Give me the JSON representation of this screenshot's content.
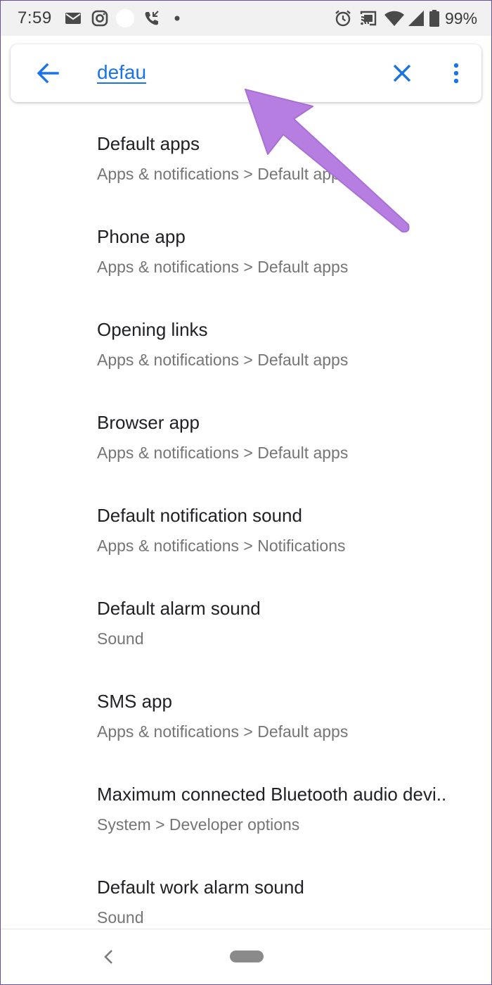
{
  "status_bar": {
    "time": "7:59",
    "battery_percent": "99%",
    "icons": [
      "email-icon",
      "instagram-icon",
      "circle-notification-icon",
      "missed-call-icon",
      "dot-icon",
      "alarm-icon",
      "cast-icon",
      "wifi-icon",
      "signal-icon",
      "battery-icon"
    ]
  },
  "search": {
    "query": "defau",
    "back_icon": "arrow-back-icon",
    "clear_icon": "close-icon",
    "menu_icon": "more-vert-icon",
    "accent_color": "#1a73e8"
  },
  "results": [
    {
      "title": "Default apps",
      "path": "Apps & notifications > Default apps"
    },
    {
      "title": "Phone app",
      "path": "Apps & notifications > Default apps"
    },
    {
      "title": "Opening links",
      "path": "Apps & notifications > Default apps"
    },
    {
      "title": "Browser app",
      "path": "Apps & notifications > Default apps"
    },
    {
      "title": "Default notification sound",
      "path": "Apps & notifications > Notifications"
    },
    {
      "title": "Default alarm sound",
      "path": "Sound"
    },
    {
      "title": "SMS app",
      "path": "Apps & notifications > Default apps"
    },
    {
      "title": "Maximum connected Bluetooth audio devi..",
      "path": "System > Developer options"
    },
    {
      "title": "Default work alarm sound",
      "path": "Sound"
    }
  ],
  "annotation": {
    "arrow_color": "#b57ee0"
  },
  "nav_bar": {
    "back_icon": "nav-back-icon",
    "home_icon": "nav-home-pill-icon"
  }
}
